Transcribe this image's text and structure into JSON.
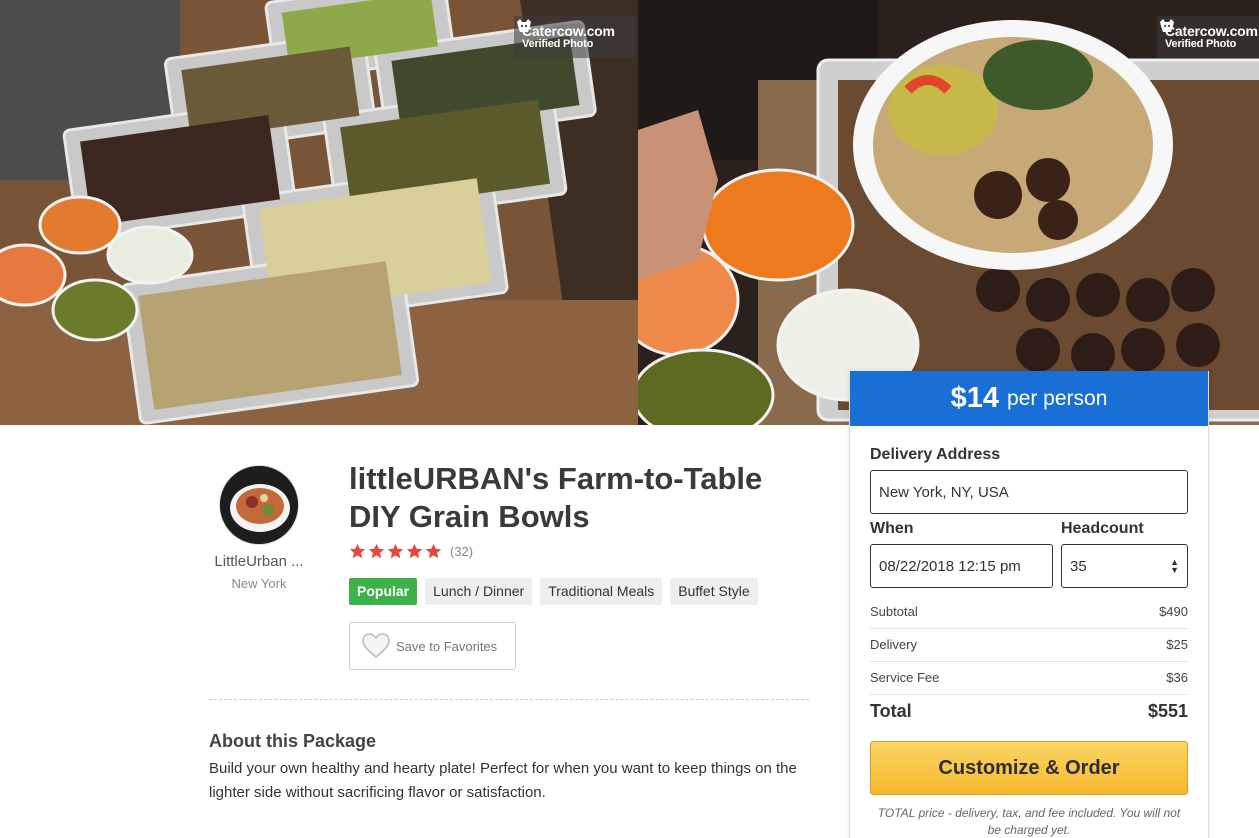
{
  "hero": {
    "badge_brand": "Catercow.com",
    "badge_sub": "Verified Photo"
  },
  "vendor": {
    "name": "LittleUrban ...",
    "city": "New York"
  },
  "package": {
    "title_line1": "littleURBAN's Farm-to-Table",
    "title_line2": "DIY Grain Bowls",
    "rating_stars": 5,
    "rating_count": "(32)",
    "tags": [
      "Popular",
      "Lunch / Dinner",
      "Traditional Meals",
      "Buffet Style"
    ],
    "favorite_label": "Save to Favorites",
    "about_heading": "About this Package",
    "about_text": "Build your own healthy and hearty plate! Perfect for when you want to keep things on the lighter side without sacrificing flavor or satisfaction."
  },
  "order": {
    "price": "$14",
    "price_unit": "per person",
    "address_label": "Delivery Address",
    "address_value": "New York, NY, USA",
    "when_label": "When",
    "when_value": "08/22/2018 12:15 pm",
    "headcount_label": "Headcount",
    "headcount_value": "35",
    "subtotal_label": "Subtotal",
    "subtotal_value": "$490",
    "delivery_label": "Delivery",
    "delivery_value": "$25",
    "service_label": "Service Fee",
    "service_value": "$36",
    "total_label": "Total",
    "total_value": "$551",
    "order_button": "Customize & Order",
    "note": "TOTAL price - delivery, tax, and fee included. You will not be charged yet."
  },
  "colors": {
    "price_bar": "#1a6fd6",
    "popular_tag": "#3cb34a",
    "order_button": "#f5b92d",
    "star": "#e5483f"
  }
}
